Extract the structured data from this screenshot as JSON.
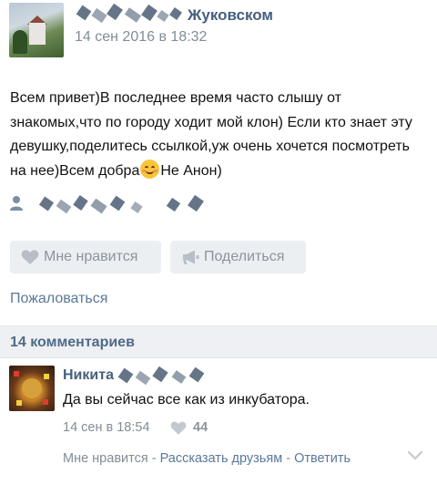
{
  "post": {
    "group_name": "Жуковском",
    "date": "14 сен 2016 в 18:32",
    "text_before_emoji": "Всем привет)В последнее время часто слышу от знакомых,что по городу ходит мой клон) Если кто знает эту девушку,поделитесь ссылкой,уж очень хочется посмотреть на нее)Всем добра",
    "text_after_emoji": "Не Анон)",
    "emoji_icon": "smiling-face-emoji-icon"
  },
  "actions": {
    "like_label": "Мне нравится",
    "share_label": "Поделиться",
    "report_label": "Пожаловаться"
  },
  "comments_header": "14 комментариев",
  "comment": {
    "author": "Никита",
    "text": "Да вы сейчас все как из инкубатора.",
    "date": "14 сен в 18:54",
    "likes": "44",
    "like_label": "Мне нравится",
    "sep1": " - ",
    "tell_friends_label": "Рассказать друзьям",
    "sep2": " - ",
    "reply_label": "Ответить"
  },
  "colors": {
    "link": "#46607e",
    "muted": "#838c96",
    "button_bg": "#eceff2",
    "section_bg": "#eef0f3"
  },
  "icons": [
    "heart-icon",
    "megaphone-icon",
    "person-icon",
    "chevron-down-icon"
  ]
}
